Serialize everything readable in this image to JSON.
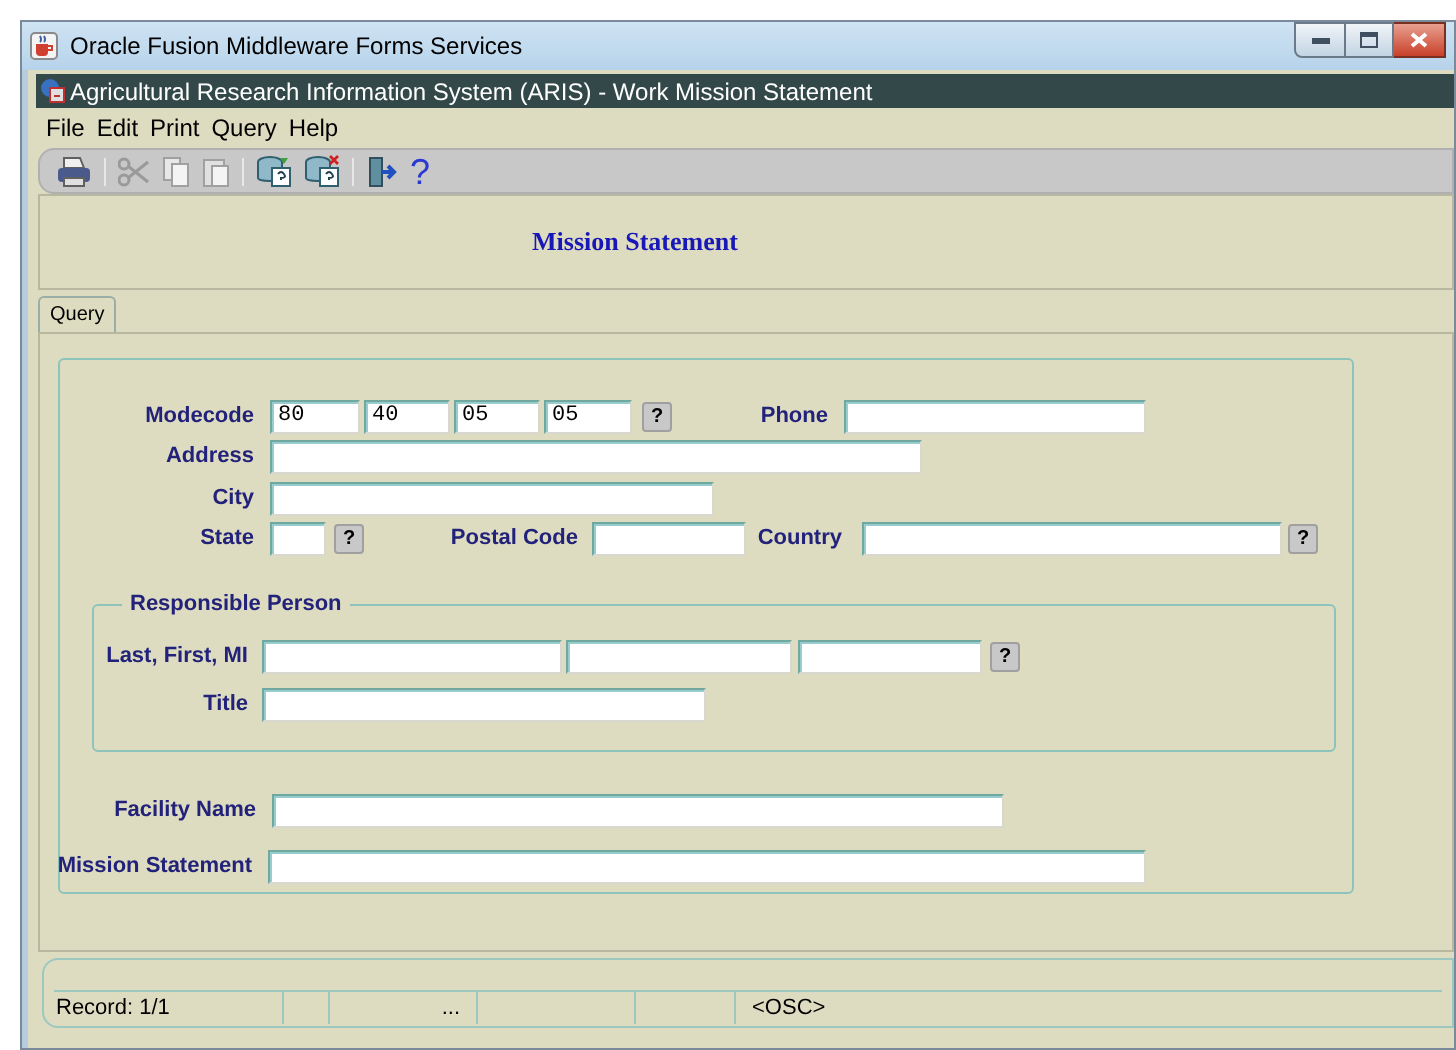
{
  "window": {
    "title": "Oracle Fusion Middleware Forms Services"
  },
  "app_title": "Agricultural Research Information System (ARIS) - Work Mission Statement",
  "menu": [
    "File",
    "Edit",
    "Print",
    "Query",
    "Help"
  ],
  "toolbar": {
    "help": "?"
  },
  "header": "Mission Statement",
  "tabs": [
    {
      "label": "Query",
      "selected": true
    }
  ],
  "form": {
    "modecode": {
      "label": "Modecode",
      "values": [
        "80",
        "40",
        "05",
        "05"
      ],
      "lov": "?"
    },
    "phone": {
      "label": "Phone"
    },
    "address": {
      "label": "Address"
    },
    "city": {
      "label": "City"
    },
    "state": {
      "label": "State",
      "lov": "?"
    },
    "postal_code": {
      "label": "Postal Code"
    },
    "country": {
      "label": "Country",
      "lov": "?"
    },
    "responsible_person": {
      "legend": "Responsible Person",
      "name_label": "Last, First, MI",
      "name_lov": "?",
      "title_label": "Title"
    },
    "facility_name": {
      "label": "Facility Name"
    },
    "mission_statement": {
      "label": "Mission Statement"
    }
  },
  "status_bar": {
    "record": "Record: 1/1",
    "ellipsis": "...",
    "mode": "<OSC>"
  }
}
